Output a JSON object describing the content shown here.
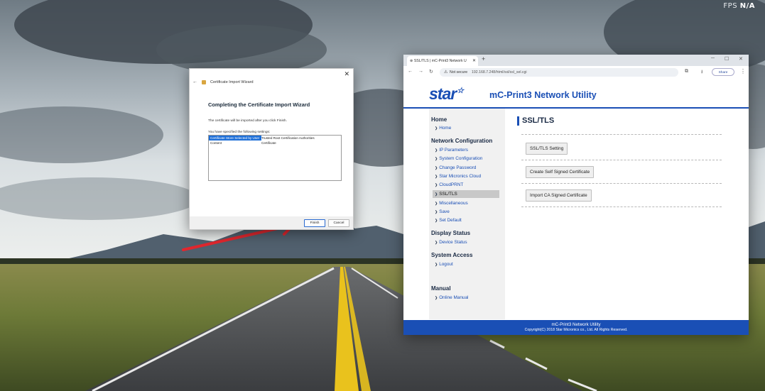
{
  "overlay": {
    "fps_label": "FPS",
    "fps_value": "N/A"
  },
  "wizard": {
    "window_title": "Certificate Import Wizard",
    "heading": "Completing the Certificate Import Wizard",
    "description": "The certificate will be imported after you click Finish.",
    "settings_label": "You have specified the following settings:",
    "settings": [
      {
        "name": "Certificate Store Selected by User",
        "value": "Trusted Root Certification Authorities"
      },
      {
        "name": "Content",
        "value": "Certificate"
      }
    ],
    "finish_label": "Finish",
    "cancel_label": "Cancel"
  },
  "browser": {
    "tab_title": "SSL/TLS | mC-Print3 Network U",
    "security_label": "Not secure",
    "url": "192.168.7.248/html/ssl/ssl_sel.cgi",
    "share_label": "Share"
  },
  "page": {
    "logo_text": "star",
    "utility_title": "mC-Print3 Network Utility",
    "sidebar": {
      "home_heading": "Home",
      "home_items": [
        "Home"
      ],
      "network_heading": "Network Configuration",
      "network_items": [
        "IP Parameters",
        "System Configuration",
        "Change Password",
        "Star Micronics Cloud",
        "CloudPRNT",
        "SSL/TLS",
        "Miscellaneous",
        "Save",
        "Set Default"
      ],
      "display_heading": "Display Status",
      "display_items": [
        "Device Status"
      ],
      "access_heading": "System Access",
      "access_items": [
        "Logout"
      ],
      "manual_heading": "Manual",
      "manual_items": [
        "Online Manual"
      ],
      "active_item": "SSL/TLS"
    },
    "content": {
      "title": "SSL/TLS",
      "buttons": [
        "SSL/TLS Setting",
        "Create Self Signed Certificate",
        "Import CA Signed Certificate"
      ]
    },
    "footer": {
      "line1": "mC-Print3 Network Utility",
      "line2": "Copyright(C) 2018 Star Micronics co., Ltd. All Rights Reserved."
    }
  },
  "colors": {
    "brand_blue": "#1a4fb5",
    "arrow_red": "#e1272e",
    "selection_blue": "#1e6fd8"
  }
}
